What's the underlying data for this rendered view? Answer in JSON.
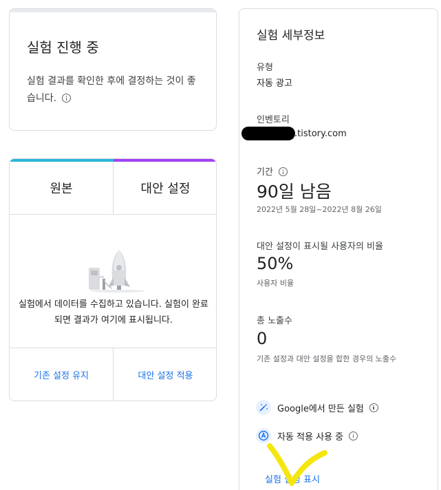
{
  "status_card": {
    "title": "실험 진행 중",
    "description": "실험 결과를 확인한 후에 결정하는 것이 좋습니다."
  },
  "comparison": {
    "original_label": "원본",
    "alternative_label": "대안 설정",
    "original_color": "#29b6d9",
    "alternative_color": "#a142f4",
    "collecting_message": "실험에서 데이터를 수집하고 있습니다. 실험이 완료되면 결과가 여기에 표시됩니다.",
    "keep_button": "기존 설정 유지",
    "apply_button": "대안 설정 적용"
  },
  "details": {
    "title": "실험 세부정보",
    "type_label": "유형",
    "type_value": "자동 광고",
    "inventory_label": "인벤토리",
    "inventory_value": ".tistory.com",
    "period_label": "기간",
    "days_left_number": "90",
    "days_left_unit": "일 남음",
    "date_range": "2022년 5월 28일~2022년 8월 26일",
    "ratio_label": "대안 설정이 표시될 사용자의 비율",
    "ratio_value": "50%",
    "ratio_sub": "사용자 비율",
    "impressions_label": "총 노출수",
    "impressions_value": "0",
    "impressions_sub": "기존 설정과 대안 설정을 합한 경우의 노출수",
    "google_experiment": "Google에서 만든 실험",
    "auto_apply": "자동 적용 사용 중",
    "show_settings_link": "실험 설정 표시",
    "accent_color": "#1a73e8"
  }
}
